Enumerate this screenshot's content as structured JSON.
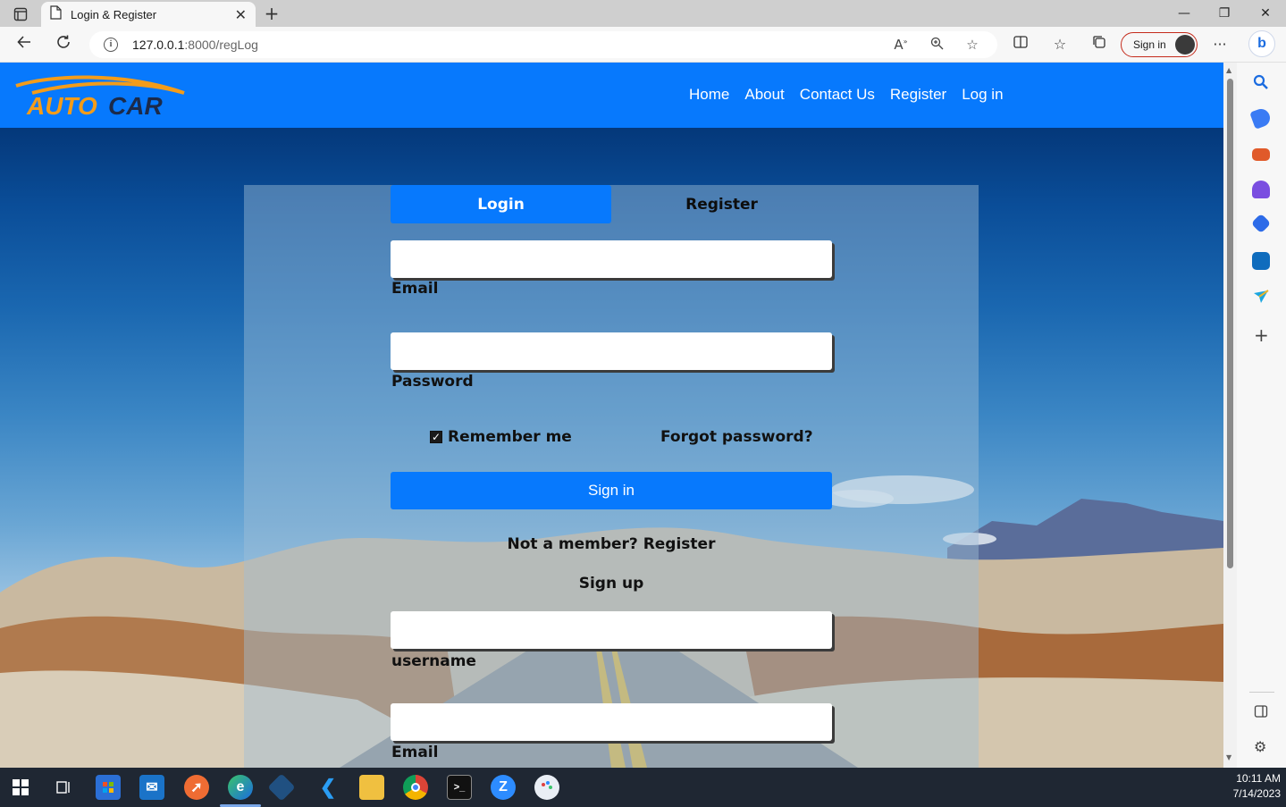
{
  "browser": {
    "tab_title": "Login & Register",
    "tab_close": "✕",
    "new_tab": "+",
    "url_host": "127.0.0.1",
    "url_path": ":8000/regLog",
    "signin_label": "Sign in",
    "window_controls": [
      "—",
      "❐",
      "✕"
    ],
    "nav_icons": [
      "back-arrow-icon",
      "refresh-icon"
    ],
    "toolbar_icons": [
      "read-aloud-icon",
      "zoom-icon",
      "favorite-star-icon",
      "split-screen-icon",
      "favorites-icon",
      "collections-icon",
      "more-menu-icon"
    ]
  },
  "sidebar": {
    "icons": [
      "search-icon",
      "shopping-tag-icon",
      "tools-briefcase-icon",
      "games-icon",
      "office-icon",
      "outlook-icon",
      "send-icon",
      "add-icon",
      "sidebar-toggle-icon",
      "settings-gear-icon"
    ],
    "colors": [
      "#1b6ce0",
      "#3a7bf4",
      "#e05a2a",
      "#7a4ee0",
      "#2d6be8",
      "#0f6cbd",
      "#1aa6e0"
    ]
  },
  "site": {
    "logo_text_auto": "AUTO",
    "logo_text_car": "CAR",
    "nav": [
      "Home",
      "About",
      "Contact Us",
      "Register",
      "Log in"
    ],
    "brand_color": "#0779fd",
    "logo_color": "#f39c1a"
  },
  "form": {
    "tab_login": "Login",
    "tab_register": "Register",
    "login": {
      "email_label": "Email",
      "email_value": "",
      "password_label": "Password",
      "password_value": "",
      "remember_label": "Remember me",
      "remember_checked": true,
      "forgot_label": "Forgot password?",
      "signin_button": "Sign in",
      "not_member_text": "Not a member?",
      "not_member_link": "Register"
    },
    "signup": {
      "title": "Sign up",
      "username_label": "username",
      "username_value": "",
      "email_label": "Email",
      "email_value": ""
    }
  },
  "taskbar": {
    "time": "10:11 AM",
    "date": "7/14/2023",
    "apps": [
      "windows-start-icon",
      "task-view-icon",
      "store-icon",
      "mail-icon",
      "postman-icon",
      "edge-icon",
      "sourcetree-icon",
      "vscode-icon",
      "file-explorer-icon",
      "chrome-icon",
      "terminal-icon",
      "zoom-icon",
      "paint-icon"
    ]
  }
}
